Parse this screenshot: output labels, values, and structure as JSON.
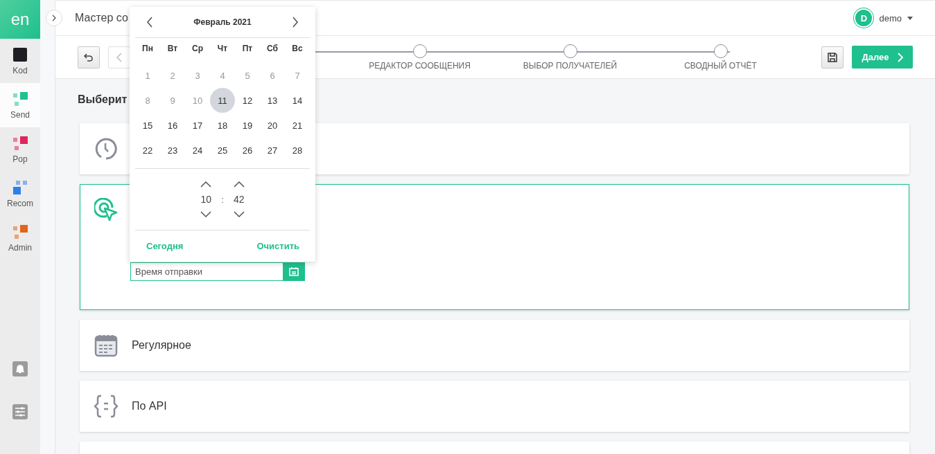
{
  "sidebar": {
    "logo": "en",
    "items": [
      {
        "label": "Kod",
        "color": "#1d1d22",
        "selected": false
      },
      {
        "label": "Send",
        "color": "#1fc190",
        "selected": true
      },
      {
        "label": "Pop",
        "color": "#e0245e",
        "selected": false
      },
      {
        "label": "Recom",
        "color": "#2f7fe8",
        "selected": false
      },
      {
        "label": "Admin",
        "color": "#e0661b",
        "selected": false
      }
    ]
  },
  "header": {
    "title": "Мастер со",
    "user": {
      "initial": "D",
      "name": "demo"
    }
  },
  "toolbar": {
    "steps": [
      {
        "label": "РЕДАКТОР СООБЩЕНИЯ"
      },
      {
        "label": "ВЫБОР ПОЛУЧАТЕЛЕЙ"
      },
      {
        "label": "СВОДНЫЙ ОТЧЁТ"
      }
    ],
    "next_button": "Далее"
  },
  "content": {
    "heading": "Выберит",
    "options": [
      {
        "kind": "clock",
        "selected": false
      },
      {
        "kind": "target",
        "selected": true,
        "field": {
          "placeholder": "Время отправки"
        }
      },
      {
        "kind": "calendar",
        "selected": false,
        "title": "Регулярное"
      },
      {
        "kind": "api",
        "selected": false,
        "title": "По API"
      },
      {
        "selected": false
      }
    ]
  },
  "datepicker": {
    "month": "Февраль 2021",
    "weekdays": [
      "Пн",
      "Вт",
      "Ср",
      "Чт",
      "Пт",
      "Сб",
      "Вс"
    ],
    "days": [
      {
        "day": "1",
        "disabled": true,
        "selected": false
      },
      {
        "day": "2",
        "disabled": true,
        "selected": false
      },
      {
        "day": "3",
        "disabled": true,
        "selected": false
      },
      {
        "day": "4",
        "disabled": true,
        "selected": false
      },
      {
        "day": "5",
        "disabled": true,
        "selected": false
      },
      {
        "day": "6",
        "disabled": true,
        "selected": false
      },
      {
        "day": "7",
        "disabled": true,
        "selected": false
      },
      {
        "day": "8",
        "disabled": true,
        "selected": false
      },
      {
        "day": "9",
        "disabled": true,
        "selected": false
      },
      {
        "day": "10",
        "disabled": true,
        "selected": false
      },
      {
        "day": "11",
        "disabled": false,
        "selected": true
      },
      {
        "day": "12",
        "disabled": false,
        "selected": false
      },
      {
        "day": "13",
        "disabled": false,
        "selected": false
      },
      {
        "day": "14",
        "disabled": false,
        "selected": false
      },
      {
        "day": "15",
        "disabled": false,
        "selected": false
      },
      {
        "day": "16",
        "disabled": false,
        "selected": false
      },
      {
        "day": "17",
        "disabled": false,
        "selected": false
      },
      {
        "day": "18",
        "disabled": false,
        "selected": false
      },
      {
        "day": "19",
        "disabled": false,
        "selected": false
      },
      {
        "day": "20",
        "disabled": false,
        "selected": false
      },
      {
        "day": "21",
        "disabled": false,
        "selected": false
      },
      {
        "day": "22",
        "disabled": false,
        "selected": false
      },
      {
        "day": "23",
        "disabled": false,
        "selected": false
      },
      {
        "day": "24",
        "disabled": false,
        "selected": false
      },
      {
        "day": "25",
        "disabled": false,
        "selected": false
      },
      {
        "day": "26",
        "disabled": false,
        "selected": false
      },
      {
        "day": "27",
        "disabled": false,
        "selected": false
      },
      {
        "day": "28",
        "disabled": false,
        "selected": false
      }
    ],
    "time": {
      "hours": "10",
      "separator": ":",
      "minutes": "42"
    },
    "today_button": "Сегодня",
    "clear_button": "Очистить"
  }
}
